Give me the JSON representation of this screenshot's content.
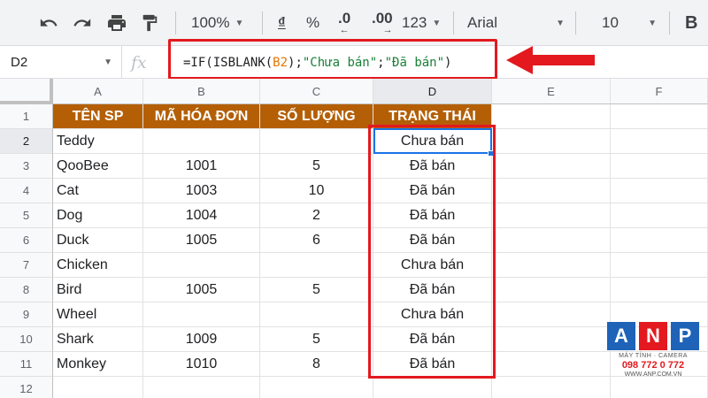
{
  "toolbar": {
    "zoom": "100%",
    "currency": "₫",
    "percent": "%",
    "decrease_decimal": ".0",
    "increase_decimal": ".00",
    "number_format": "123",
    "font": "Arial",
    "font_size": "10",
    "bold": "B"
  },
  "formula_bar": {
    "cell_ref": "D2",
    "fx": "fx",
    "formula_start": "=IF(ISBLANK(",
    "formula_ref": "B2",
    "formula_sep1": ");",
    "formula_str1": "\"Chưa bán\"",
    "formula_sep2": ";",
    "formula_str2": "\"Đã bán\"",
    "formula_end": ")"
  },
  "columns": [
    "A",
    "B",
    "C",
    "D",
    "E",
    "F"
  ],
  "rows": [
    "1",
    "2",
    "3",
    "4",
    "5",
    "6",
    "7",
    "8",
    "9",
    "10",
    "11",
    "12"
  ],
  "table": {
    "headers": [
      "TÊN SP",
      "MÃ HÓA ĐƠN",
      "SỐ LƯỢNG",
      "TRẠNG THÁI"
    ],
    "data": [
      [
        "Teddy",
        "",
        "",
        "Chưa bán"
      ],
      [
        "QooBee",
        "1001",
        "5",
        "Đã bán"
      ],
      [
        "Cat",
        "1003",
        "10",
        "Đã bán"
      ],
      [
        "Dog",
        "1004",
        "2",
        "Đã bán"
      ],
      [
        "Duck",
        "1005",
        "6",
        "Đã bán"
      ],
      [
        "Chicken",
        "",
        "",
        "Chưa bán"
      ],
      [
        "Bird",
        "1005",
        "5",
        "Đã bán"
      ],
      [
        "Wheel",
        "",
        "",
        "Chưa bán"
      ],
      [
        "Shark",
        "1009",
        "5",
        "Đã bán"
      ],
      [
        "Monkey",
        "1010",
        "8",
        "Đã bán"
      ]
    ]
  },
  "logo": {
    "letters": [
      "A",
      "N",
      "P"
    ],
    "colors": [
      "#1e63b8",
      "#e3191f",
      "#1e63b8"
    ],
    "tagline": "MÁY TÍNH · CAMERA",
    "phone": "098 772 0 772",
    "website": "WWW.ANP.COM.VN"
  },
  "colors": {
    "header_fill": "#b45f06",
    "highlight": "#e3191f",
    "selection": "#1a73e8"
  }
}
